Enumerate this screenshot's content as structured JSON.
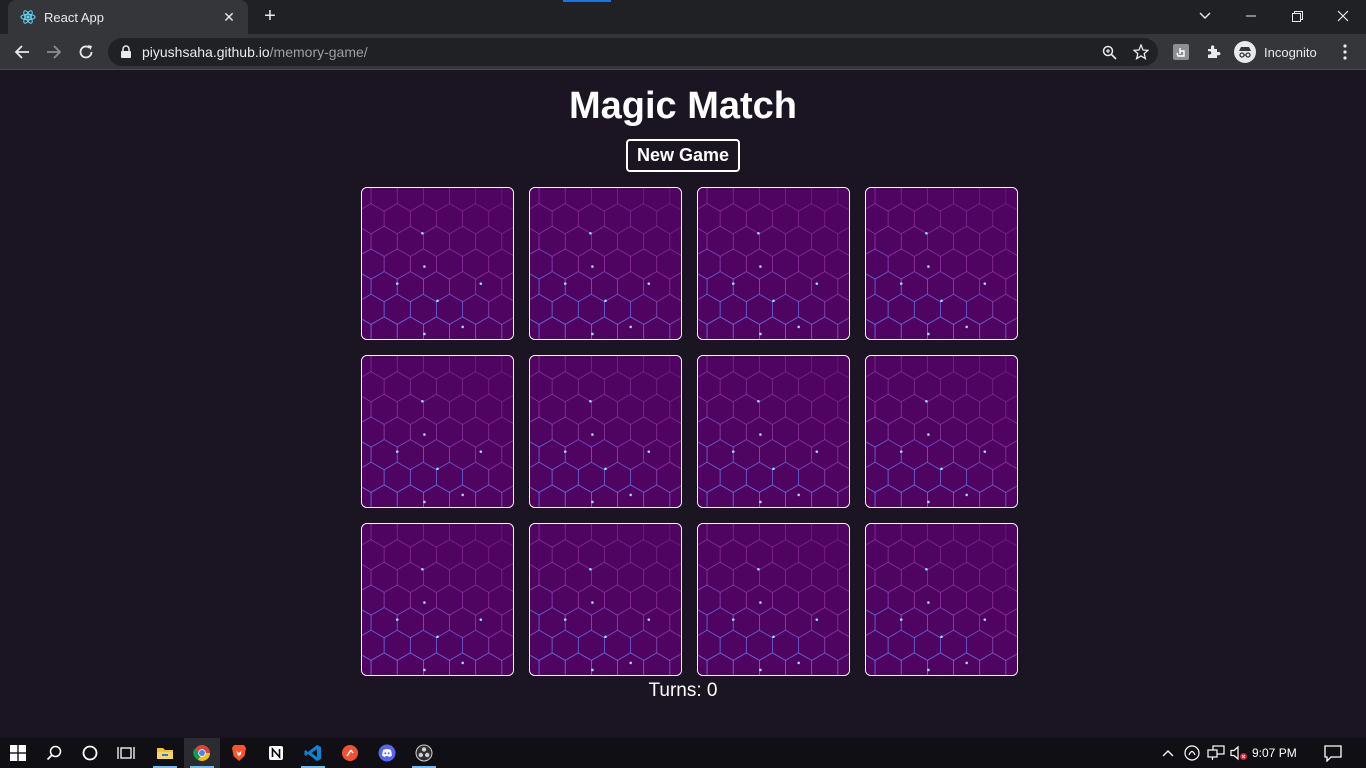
{
  "browser": {
    "tab_title": "React App",
    "url_host": "piyushsaha.github.io",
    "url_path": "/memory-game/",
    "profile_label": "Incognito"
  },
  "game": {
    "title": "Magic Match",
    "new_game_label": "New Game",
    "turns_label": "Turns: 0",
    "card_count": 12,
    "card_back_color": "#4f0461",
    "card_border_color": "#ffffff"
  },
  "taskbar": {
    "time": "9:07 PM",
    "apps": [
      "windows-start",
      "search",
      "cortana",
      "task-view",
      "file-explorer",
      "chrome",
      "brave",
      "notion",
      "vscode",
      "git-app",
      "discord",
      "obs"
    ]
  },
  "colors": {
    "page_background": "#1b1523",
    "chrome_dark": "#202124",
    "chrome_toolbar": "#35363a"
  }
}
